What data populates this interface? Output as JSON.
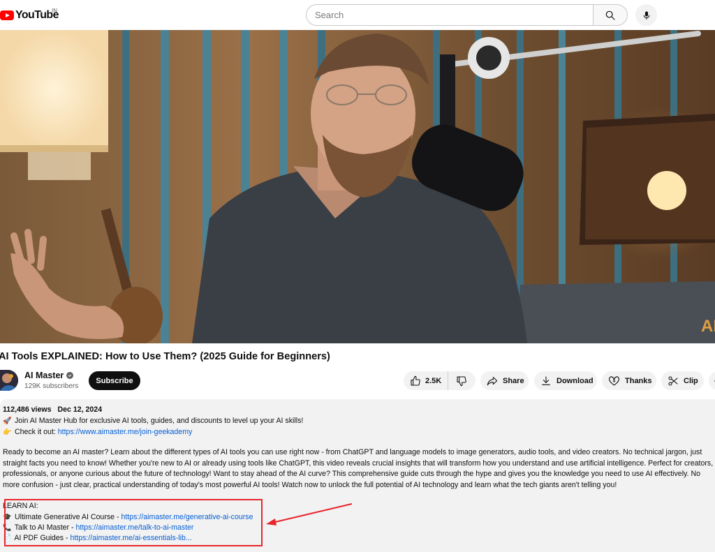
{
  "header": {
    "logo_text": "YouTube",
    "region": "IN",
    "search_placeholder": "Search"
  },
  "video": {
    "watermark": "AI",
    "title": "AI Tools EXPLAINED: How to Use Them? (2025 Guide for Beginners)"
  },
  "channel": {
    "name": "AI Master",
    "subscribers": "129K subscribers",
    "subscribe_label": "Subscribe"
  },
  "actions": {
    "like_count": "2.5K",
    "share_label": "Share",
    "download_label": "Download",
    "thanks_label": "Thanks",
    "clip_label": "Clip"
  },
  "description": {
    "views": "112,486 views",
    "date": "Dec 12, 2024",
    "line1_icon": "🚀",
    "line1_text": "Join AI Master Hub for exclusive AI tools, guides, and discounts to level up your AI skills!",
    "line2_icon": "👉",
    "line2_prefix": "Check it out: ",
    "line2_link": "https://www.aimaster.me/join-geekademy",
    "paragraph": "Ready to become an AI master? Learn about the different types of AI tools you can use right now - from ChatGPT and language models to image generators, audio tools, and video creators. No technical jargon, just straight facts you need to know! Whether you're new to AI or already using tools like ChatGPT, this video reveals crucial insights that will transform how you understand and use artificial intelligence. Perfect for creators, professionals, or anyone curious about the future of technology! Want to stay ahead of the AI curve? This comprehensive guide cuts through the hype and gives you the knowledge you need to use AI effectively. No more confusion - just clear, practical understanding of today's most powerful AI tools! Watch now to unlock the full potential of AI technology and learn what the tech giants aren't telling you!",
    "learn_heading": "LEARN AI:",
    "learn_items": [
      {
        "icon": "🎓",
        "prefix": "Ultimate Generative AI Course - ",
        "link": "https://aimaster.me/generative-ai-course"
      },
      {
        "icon": "📞",
        "prefix": "Talk to AI Master - ",
        "link": "https://aimaster.me/talk-to-ai-master"
      },
      {
        "icon": "📄",
        "prefix": "AI PDF Guides - ",
        "link": "https://aimaster.me/ai-essentials-lib..."
      }
    ]
  },
  "colors": {
    "brand_red": "#ff0000",
    "link_blue": "#065fd4",
    "annotation_red": "#e8252b"
  },
  "icons": [
    "youtube-logo-icon",
    "search-icon",
    "microphone-icon",
    "verified-icon",
    "thumbs-up-icon",
    "thumbs-down-icon",
    "share-icon",
    "download-icon",
    "thanks-icon",
    "scissors-icon",
    "annotation-arrow"
  ]
}
